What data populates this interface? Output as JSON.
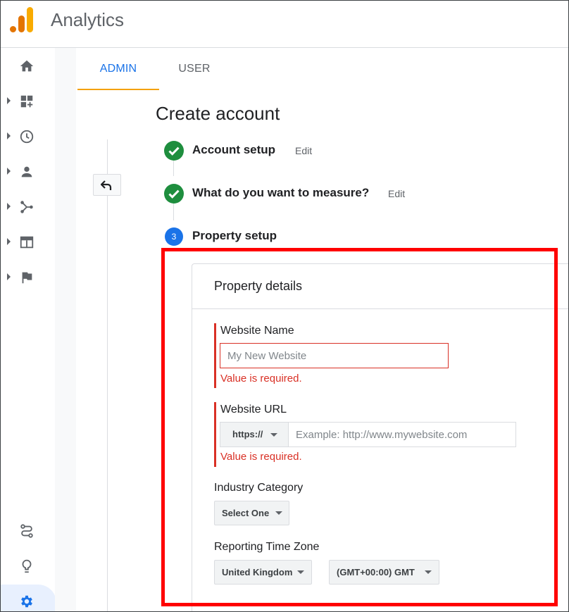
{
  "app": {
    "title": "Analytics",
    "brand_colors": [
      "#f9ab00",
      "#e37400"
    ]
  },
  "sidebar": {
    "items": [
      {
        "icon": "home-icon",
        "has_caret": false
      },
      {
        "icon": "dashboard-customize-icon",
        "has_caret": true
      },
      {
        "icon": "clock-icon",
        "has_caret": true
      },
      {
        "icon": "person-icon",
        "has_caret": true
      },
      {
        "icon": "acquisition-icon",
        "has_caret": true
      },
      {
        "icon": "behavior-icon",
        "has_caret": true
      },
      {
        "icon": "flag-icon",
        "has_caret": true
      }
    ],
    "bottom": [
      {
        "icon": "route-icon"
      },
      {
        "icon": "lightbulb-icon"
      },
      {
        "icon": "gear-icon",
        "active": true
      }
    ]
  },
  "tabs": [
    {
      "label": "ADMIN",
      "active": true
    },
    {
      "label": "USER",
      "active": false
    }
  ],
  "page": {
    "title": "Create account"
  },
  "steps": [
    {
      "label": "Account setup",
      "edit": "Edit",
      "status": "done"
    },
    {
      "label": "What do you want to measure?",
      "edit": "Edit",
      "status": "done"
    },
    {
      "number": "3",
      "label": "Property setup",
      "status": "current"
    }
  ],
  "property": {
    "title": "Property details",
    "website_name": {
      "label": "Website Name",
      "placeholder": "My New Website",
      "value": "",
      "error": "Value is required."
    },
    "website_url": {
      "label": "Website URL",
      "protocol": "https://",
      "placeholder": "Example: http://www.mywebsite.com",
      "value": "",
      "error": "Value is required."
    },
    "industry": {
      "label": "Industry Category",
      "selected": "Select One"
    },
    "timezone": {
      "label": "Reporting Time Zone",
      "country": "United Kingdom",
      "zone": "(GMT+00:00) GMT"
    }
  },
  "colors": {
    "accent": "#1a73e8",
    "tab_indicator": "#f4a10a",
    "success": "#1e8e3e",
    "error": "#d93025",
    "highlight": "#ff0000"
  }
}
